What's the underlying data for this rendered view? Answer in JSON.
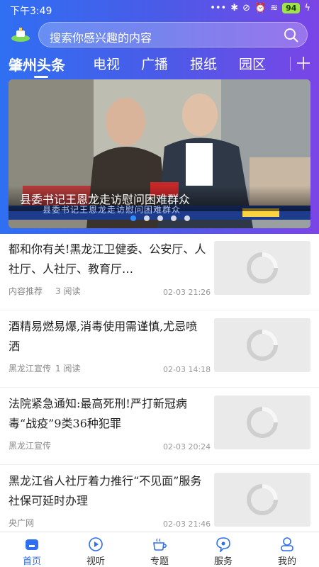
{
  "status_bar": {
    "time": "下午3:49",
    "battery": "94"
  },
  "search": {
    "placeholder": "搜索你感兴趣的内容"
  },
  "tabs": [
    {
      "label": "肇州头条"
    },
    {
      "label": "电视"
    },
    {
      "label": "广播"
    },
    {
      "label": "报纸"
    },
    {
      "label": "园区"
    }
  ],
  "banner": {
    "caption": "县委书记王恩龙走访慰问困难群众",
    "video_subtitle": "县委书记王恩龙走访慰问困难群众",
    "pages": 5,
    "current_page": 1
  },
  "news": [
    {
      "title": "都和你有关!黑龙江卫健委、公安厅、人社厅、人社厅、教育厅…",
      "source": "内容推荐",
      "reads": "3 阅读",
      "time": "02-03 21:26"
    },
    {
      "title": "酒精易燃易爆,消毒使用需谨慎,尤忌喷洒",
      "source": "黑龙江宣传",
      "reads": "1 阅读",
      "time": "02-03 14:18"
    },
    {
      "title": "法院紧急通知:最高死刑!严打新冠病毒“战疫”9类36种犯罪",
      "source": "黑龙江宣传",
      "reads": "",
      "time": "02-03 20:24"
    },
    {
      "title": "黑龙江省人社厅着力推行“不见面”服务 社保可延时办理",
      "source": "央广网",
      "reads": "",
      "time": "02-03 21:46"
    }
  ],
  "bottom_nav": [
    {
      "label": "首页",
      "icon": "home-icon"
    },
    {
      "label": "视听",
      "icon": "play-icon"
    },
    {
      "label": "专题",
      "icon": "cup-icon"
    },
    {
      "label": "服务",
      "icon": "chat-icon"
    },
    {
      "label": "我的",
      "icon": "user-icon"
    }
  ],
  "colors": {
    "accent": "#2f6ff2",
    "header_start": "#2f6ff2",
    "header_end": "#7b45e6"
  }
}
